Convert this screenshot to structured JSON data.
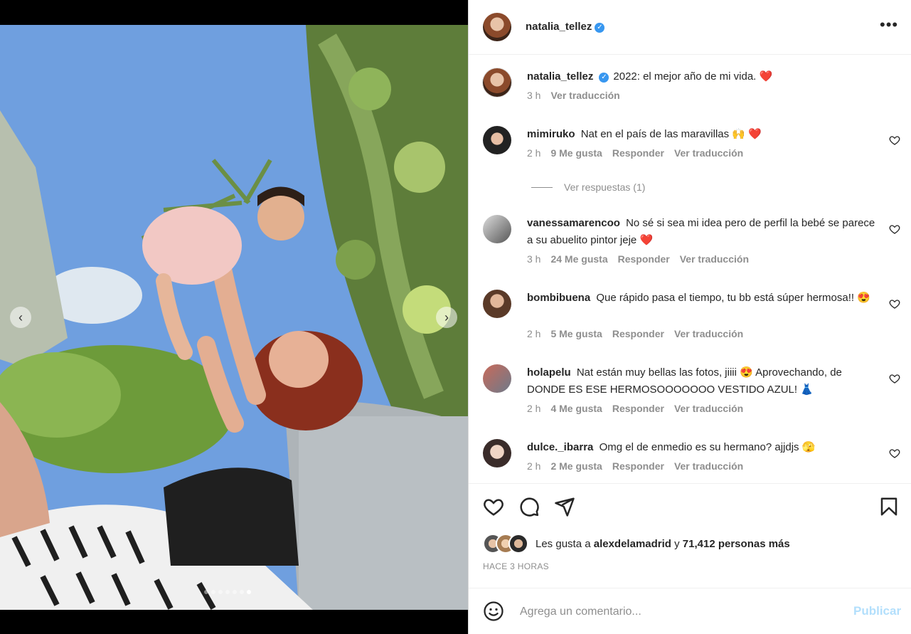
{
  "post": {
    "username": "natalia_tellez",
    "verified_icon": "verified-badge-icon",
    "more_icon": "more-options-icon",
    "more_label": "•••"
  },
  "photo": {
    "prev_icon": "chevron-left-icon",
    "next_icon": "chevron-right-icon",
    "prev_glyph": "‹",
    "next_glyph": "›",
    "carousel_slide_count": 7,
    "carousel_active_index": 6
  },
  "caption": {
    "username": "natalia_tellez",
    "text": "2022: el mejor año de mi vida. ❤️",
    "time": "3 h",
    "translate": "Ver traducción"
  },
  "comments": [
    {
      "username": "mimiruko",
      "text": "Nat en el país de las maravillas 🙌 ❤️",
      "time": "2 h",
      "likes": "9 Me gusta",
      "reply": "Responder",
      "translate": "Ver traducción"
    },
    {
      "username": "vanessamarencoo",
      "text": "No sé si sea mi idea pero de perfil la bebé se parece a su abuelito pintor jeje ❤️",
      "time": "3 h",
      "likes": "24 Me gusta",
      "reply": "Responder",
      "translate": "Ver traducción"
    },
    {
      "username": "bombibuena",
      "text": "Que rápido pasa el tiempo, tu bb está súper hermosa!! 😍",
      "time": "2 h",
      "likes": "5 Me gusta",
      "reply": "Responder",
      "translate": "Ver traducción"
    },
    {
      "username": "holapelu",
      "text": "Nat están muy bellas las fotos, jiiii 😍 Aprovechando, de DONDE ES ESE HERMOSOOOOOOO VESTIDO AZUL! 👗",
      "time": "2 h",
      "likes": "4 Me gusta",
      "reply": "Responder",
      "translate": "Ver traducción"
    },
    {
      "username": "dulce._ibarra",
      "text": "Omg el de enmedio es su hermano? ajjdjs 🫣",
      "time": "2 h",
      "likes": "2 Me gusta",
      "reply": "Responder",
      "translate": "Ver traducción"
    }
  ],
  "view_replies": "Ver respuestas (1)",
  "likes": {
    "prefix": "Les gusta a",
    "user": "alexdelamadrid",
    "conj": "y",
    "count": "71,412 personas más"
  },
  "timestamp": "HACE 3 HORAS",
  "add_comment": {
    "placeholder": "Agrega un comentario...",
    "publish": "Publicar"
  },
  "colors": {
    "accent_blue": "#3897f0",
    "publish_disabled": "#b2dffc",
    "heart_red": "#ed4956",
    "secondary_text": "#8e8e8e"
  }
}
